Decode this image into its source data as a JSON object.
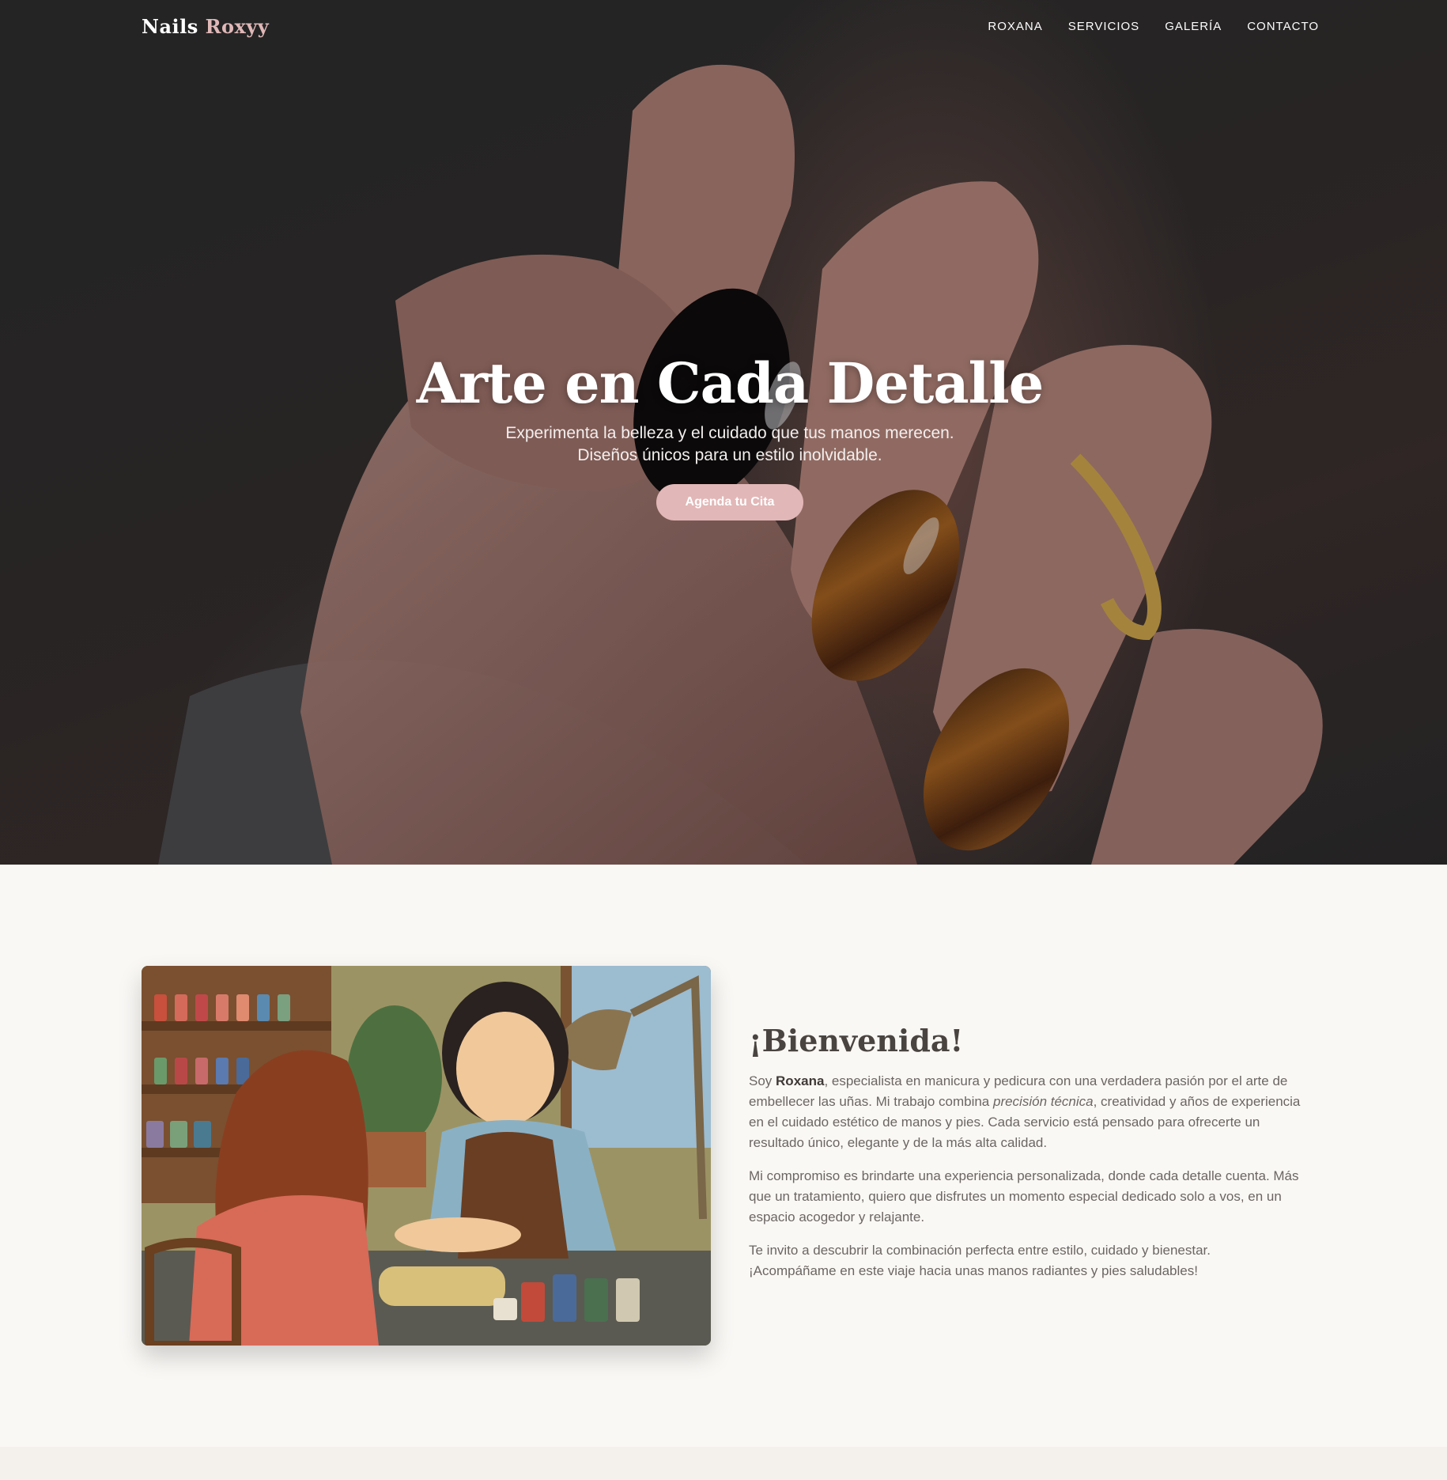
{
  "brand": {
    "name_main": "Nails",
    "name_accent": "Roxyy",
    "accent_color": "#e0b8b8"
  },
  "nav": {
    "items": [
      {
        "label": "ROXANA"
      },
      {
        "label": "SERVICIOS"
      },
      {
        "label": "GALERÍA"
      },
      {
        "label": "CONTACTO"
      }
    ]
  },
  "hero": {
    "title": "Arte en Cada Detalle",
    "subtitle_line1": "Experimenta la belleza y el cuidado que tus manos merecen.",
    "subtitle_line2": "Diseños únicos para un estilo inolvidable.",
    "cta_label": "Agenda tu Cita",
    "cta_color": "#e2b7b7"
  },
  "about": {
    "title": "¡Bienvenida!",
    "p1_prefix": "Soy ",
    "p1_name": "Roxana",
    "p1_mid": ", especialista en manicura y pedicura con una verdadera pasión por el arte de embellecer las uñas. Mi trabajo combina ",
    "p1_em": "precisión técnica",
    "p1_suffix": ", creatividad y años de experiencia en el cuidado estético de manos y pies. Cada servicio está pensado para ofrecerte un resultado único, elegante y de la más alta calidad.",
    "p2": "Mi compromiso es brindarte una experiencia personalizada, donde cada detalle cuenta. Más que un tratamiento, quiero que disfrutes un momento especial dedicado solo a vos, en un espacio acogedor y relajante.",
    "p3_line1": "Te invito a descubrir la combinación perfecta entre estilo, cuidado y bienestar.",
    "p3_line2": "¡Acompáñame en este viaje hacia unas manos radiantes y pies saludables!"
  }
}
